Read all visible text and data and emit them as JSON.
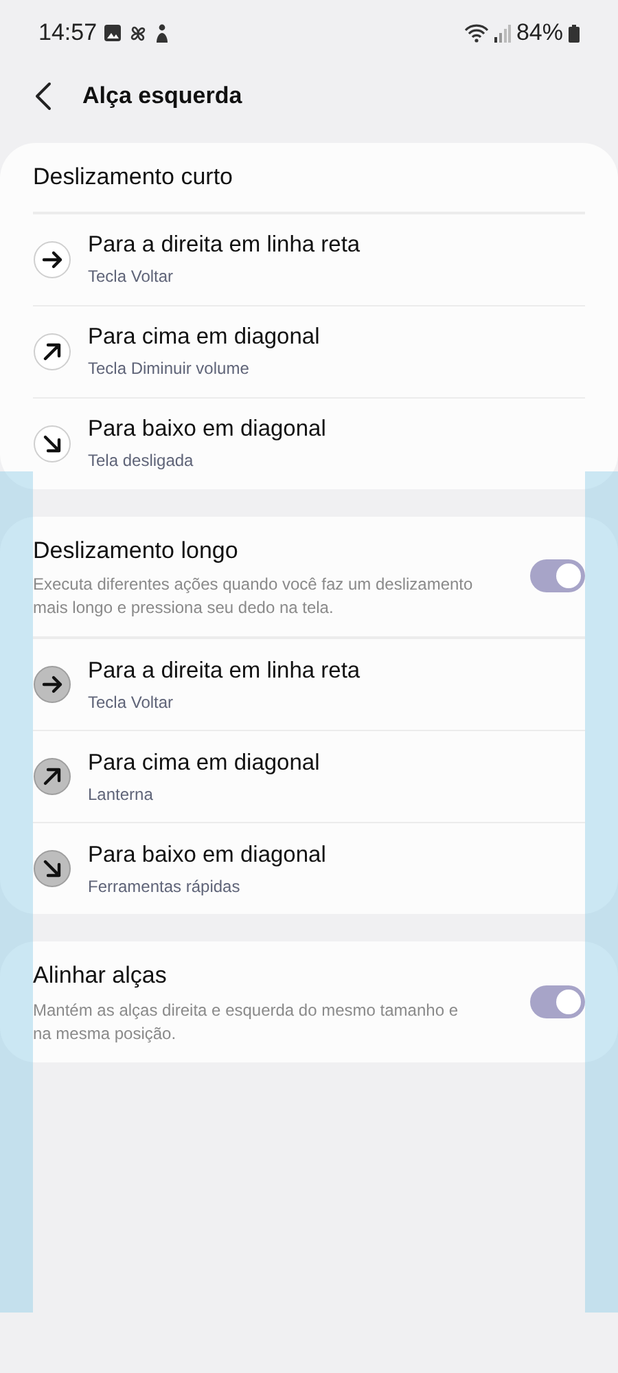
{
  "status_bar": {
    "time": "14:57",
    "battery": "84%"
  },
  "header": {
    "title": "Alça esquerda"
  },
  "sections": [
    {
      "title": "Deslizamento curto",
      "icons_filled": false,
      "rows": [
        {
          "kind": "right",
          "title": "Para a direita em linha reta",
          "subtitle": "Tecla Voltar"
        },
        {
          "kind": "up_right",
          "title": "Para cima em diagonal",
          "subtitle": "Tecla Diminuir volume"
        },
        {
          "kind": "down_right",
          "title": "Para baixo em diagonal",
          "subtitle": "Tela desligada"
        }
      ]
    },
    {
      "title": "Deslizamento longo",
      "description": "Executa diferentes ações quando você faz um deslizamento mais longo e pressiona seu dedo na tela.",
      "on": true,
      "icons_filled": true,
      "rows": [
        {
          "kind": "right",
          "title": "Para a direita em linha reta",
          "subtitle": "Tecla Voltar"
        },
        {
          "kind": "up_right",
          "title": "Para cima em diagonal",
          "subtitle": "Lanterna"
        },
        {
          "kind": "down_right",
          "title": "Para baixo em diagonal",
          "subtitle": "Ferramentas rápidas"
        }
      ]
    },
    {
      "title": "Alinhar alças",
      "description": "Mantém as alças direita e esquerda do mesmo tamanho e na mesma posição.",
      "on": true
    }
  ]
}
